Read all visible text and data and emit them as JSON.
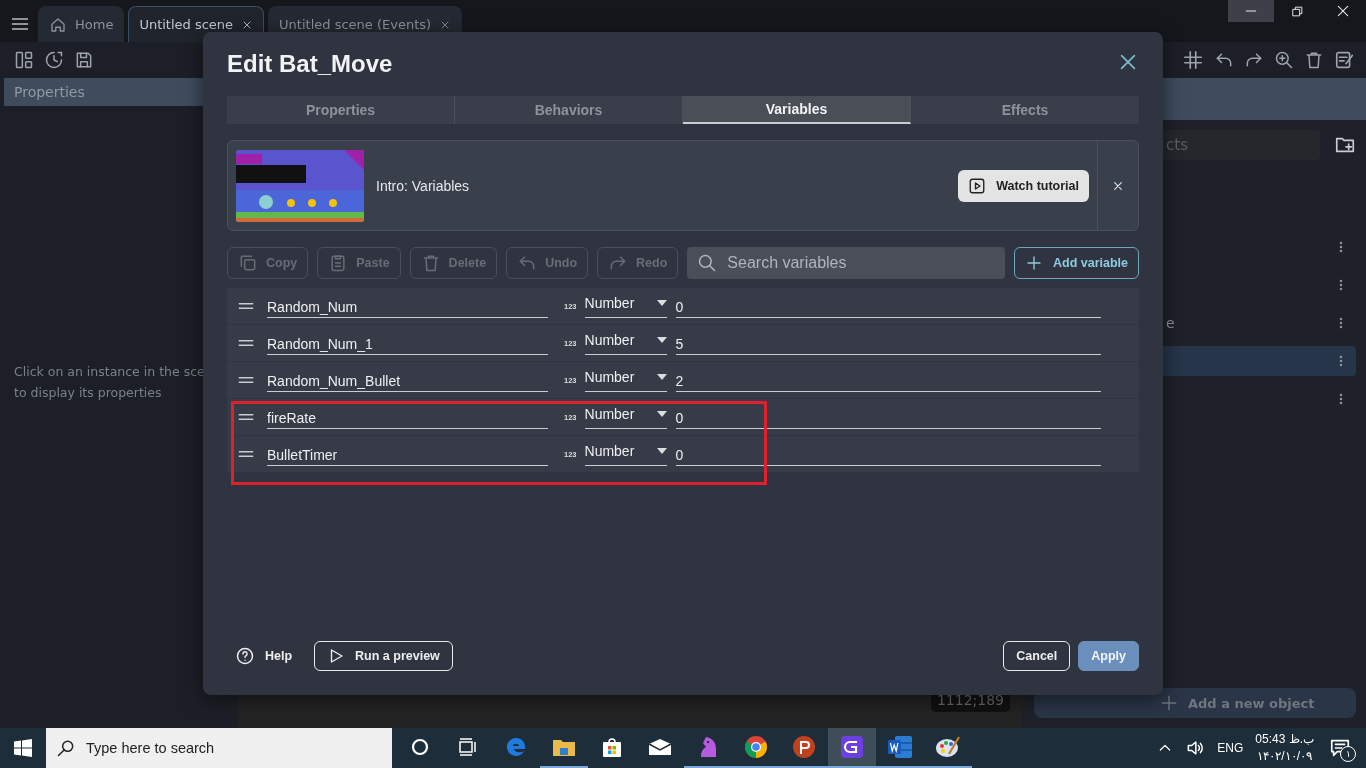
{
  "app_tabs": [
    {
      "kind": "home",
      "label": "Home",
      "selected": false
    },
    {
      "kind": "scene",
      "label": "Untitled scene",
      "selected": true
    },
    {
      "kind": "scene",
      "label": "Untitled scene (Events)",
      "selected": false
    }
  ],
  "left_panel": {
    "title": "Properties",
    "message": [
      "Click on an instance in the sce",
      "to display its properties"
    ]
  },
  "canvas": {
    "cursor_position": "1112;189"
  },
  "right_panel": {
    "search_placeholder": "cts",
    "items": [
      {
        "selected": false
      },
      {
        "selected": false
      },
      {
        "label": "e",
        "selected": false
      },
      {
        "selected": true
      },
      {
        "selected": false
      }
    ],
    "add_button": "Add a new object"
  },
  "dialog": {
    "title": "Edit Bat_Move",
    "tabs": [
      {
        "label": "Properties",
        "selected": false
      },
      {
        "label": "Behaviors",
        "selected": false
      },
      {
        "label": "Variables",
        "selected": true
      },
      {
        "label": "Effects",
        "selected": false
      }
    ],
    "tutorial": {
      "title": "Intro: Variables",
      "button": "Watch tutorial"
    },
    "toolbar": [
      {
        "kind": "copy",
        "label": "Copy",
        "disabled": true
      },
      {
        "kind": "paste",
        "label": "Paste",
        "disabled": true
      },
      {
        "kind": "delete",
        "label": "Delete",
        "disabled": true
      },
      {
        "kind": "undo",
        "label": "Undo",
        "disabled": true
      },
      {
        "kind": "redo",
        "label": "Redo",
        "disabled": true
      }
    ],
    "search_placeholder": "Search variables",
    "add_button": "Add variable",
    "variables": [
      {
        "name": "Random_Num",
        "type_icon": "123",
        "type": "Number",
        "value": "0",
        "highlighted": false
      },
      {
        "name": "Random_Num_1",
        "type_icon": "123",
        "type": "Number",
        "value": "5",
        "highlighted": false
      },
      {
        "name": "Random_Num_Bullet",
        "type_icon": "123",
        "type": "Number",
        "value": "2",
        "highlighted": false
      },
      {
        "name": "fireRate",
        "type_icon": "123",
        "type": "Number",
        "value": "0",
        "highlighted": true
      },
      {
        "name": "BulletTimer",
        "type_icon": "123",
        "type": "Number",
        "value": "0",
        "highlighted": true
      }
    ],
    "help": "Help",
    "preview": "Run a preview",
    "cancel": "Cancel",
    "apply": "Apply"
  },
  "taskbar": {
    "search_placeholder": "Type here to search",
    "apps": [
      {
        "kind": "cortana",
        "running": false,
        "selected": false
      },
      {
        "kind": "taskview",
        "running": false,
        "selected": false
      },
      {
        "kind": "edge",
        "running": false,
        "selected": false
      },
      {
        "kind": "explorer",
        "running": true,
        "selected": false
      },
      {
        "kind": "store",
        "running": false,
        "selected": false
      },
      {
        "kind": "mail",
        "running": false,
        "selected": false
      },
      {
        "kind": "horse",
        "running": true,
        "selected": false
      },
      {
        "kind": "chrome",
        "running": true,
        "selected": false
      },
      {
        "kind": "psiphon",
        "running": true,
        "selected": false
      },
      {
        "kind": "gdevelop",
        "running": true,
        "selected": true
      },
      {
        "kind": "word",
        "running": true,
        "selected": false
      },
      {
        "kind": "paint",
        "running": true,
        "selected": false
      }
    ],
    "language": "ENG",
    "time": "05:43 ب.ظ",
    "date": "۱۴۰۲/۱۰/۰۹",
    "notification_count": "۱"
  }
}
